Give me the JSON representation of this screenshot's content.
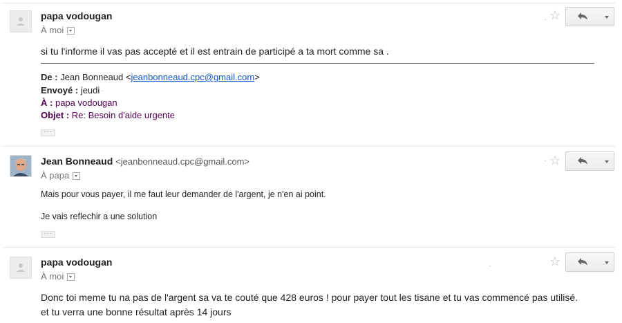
{
  "messages": [
    {
      "sender": "papa vodougan",
      "sender_email": "",
      "to_prefix": "À",
      "to": "moi",
      "body_lines": [
        "si tu l'informe il vas pas accepté et il est entrain de participé a ta mort comme sa ."
      ],
      "quoted": {
        "from_label": "De :",
        "from_name": "Jean Bonneaud <",
        "from_email": "jeanbonneaud.cpc@gmail.com",
        "from_close": ">",
        "sent_label": "Envoyé :",
        "sent_value": "jeudi",
        "to_label": "À :",
        "to_value": "papa vodougan",
        "subject_label": "Objet :",
        "subject_value": "Re: Besoin d'aide urgente"
      },
      "ellipsis": "···"
    },
    {
      "sender": "Jean Bonneaud",
      "sender_email": "<jeanbonneaud.cpc@gmail.com>",
      "to_prefix": "À",
      "to": "papa",
      "body_lines": [
        "Mais pour vous payer, il me faut leur demander de l'argent, je n'en ai point.",
        "Je vais reflechir a une solution"
      ],
      "ellipsis": "···"
    },
    {
      "sender": "papa vodougan",
      "sender_email": "",
      "to_prefix": "À",
      "to": "moi",
      "body_lines": [
        "Donc toi meme tu na pas de l'argent sa va te couté que 428 euros ! pour  payer tout les tisane et tu vas commencé pas utilisé.",
        "et tu verra une bonne résultat après 14 jours"
      ]
    }
  ],
  "icons": {
    "star": "star-icon",
    "reply": "reply-arrow-icon",
    "more": "chevron-down-icon",
    "avatar_placeholder": "person-silhouette-icon",
    "avatar_photo": "profile-photo"
  },
  "colors": {
    "link": "#1155cc",
    "quoted_purple": "#500050",
    "divider": "#e5e5e5"
  }
}
